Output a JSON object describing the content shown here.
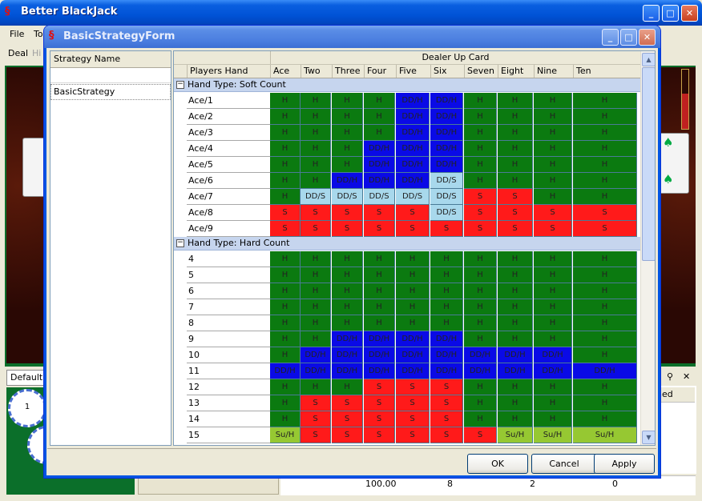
{
  "main_window": {
    "title": "Better BlackJack",
    "menu": [
      "File",
      "To"
    ],
    "toolbar": [
      "Deal",
      "Hi"
    ],
    "default_tab": "Default",
    "right_header_partial": "hed",
    "stats_row": [
      "100.00",
      "8",
      "2",
      "0"
    ],
    "chip_label": "1"
  },
  "dialog": {
    "title": "BasicStrategyForm",
    "strategy_header": "Strategy Name",
    "strategies": [
      "BasicStrategy"
    ],
    "grid": {
      "group_header": "Dealer Up Card",
      "hand_header": "Players Hand",
      "columns": [
        "Ace",
        "Two",
        "Three",
        "Four",
        "Five",
        "Six",
        "Seven",
        "Eight",
        "Nine",
        "Ten"
      ],
      "sections": [
        {
          "label": "Hand Type:  Soft Count",
          "rows": [
            {
              "hand": "Ace/1",
              "cells": [
                "H",
                "H",
                "H",
                "H",
                "DD/H",
                "DD/H",
                "H",
                "H",
                "H",
                "H"
              ]
            },
            {
              "hand": "Ace/2",
              "cells": [
                "H",
                "H",
                "H",
                "H",
                "DD/H",
                "DD/H",
                "H",
                "H",
                "H",
                "H"
              ]
            },
            {
              "hand": "Ace/3",
              "cells": [
                "H",
                "H",
                "H",
                "H",
                "DD/H",
                "DD/H",
                "H",
                "H",
                "H",
                "H"
              ]
            },
            {
              "hand": "Ace/4",
              "cells": [
                "H",
                "H",
                "H",
                "DD/H",
                "DD/H",
                "DD/H",
                "H",
                "H",
                "H",
                "H"
              ]
            },
            {
              "hand": "Ace/5",
              "cells": [
                "H",
                "H",
                "H",
                "DD/H",
                "DD/H",
                "DD/H",
                "H",
                "H",
                "H",
                "H"
              ]
            },
            {
              "hand": "Ace/6",
              "cells": [
                "H",
                "H",
                "DD/H",
                "DD/H",
                "DD/H",
                "DD/S",
                "H",
                "H",
                "H",
                "H"
              ]
            },
            {
              "hand": "Ace/7",
              "cells": [
                "H",
                "DD/S",
                "DD/S",
                "DD/S",
                "DD/S",
                "DD/S",
                "S",
                "S",
                "H",
                "H"
              ]
            },
            {
              "hand": "Ace/8",
              "cells": [
                "S",
                "S",
                "S",
                "S",
                "S",
                "DD/S",
                "S",
                "S",
                "S",
                "S"
              ]
            },
            {
              "hand": "Ace/9",
              "cells": [
                "S",
                "S",
                "S",
                "S",
                "S",
                "S",
                "S",
                "S",
                "S",
                "S"
              ]
            }
          ]
        },
        {
          "label": "Hand Type:  Hard Count",
          "rows": [
            {
              "hand": "4",
              "cells": [
                "H",
                "H",
                "H",
                "H",
                "H",
                "H",
                "H",
                "H",
                "H",
                "H"
              ]
            },
            {
              "hand": "5",
              "cells": [
                "H",
                "H",
                "H",
                "H",
                "H",
                "H",
                "H",
                "H",
                "H",
                "H"
              ]
            },
            {
              "hand": "6",
              "cells": [
                "H",
                "H",
                "H",
                "H",
                "H",
                "H",
                "H",
                "H",
                "H",
                "H"
              ]
            },
            {
              "hand": "7",
              "cells": [
                "H",
                "H",
                "H",
                "H",
                "H",
                "H",
                "H",
                "H",
                "H",
                "H"
              ]
            },
            {
              "hand": "8",
              "cells": [
                "H",
                "H",
                "H",
                "H",
                "H",
                "H",
                "H",
                "H",
                "H",
                "H"
              ]
            },
            {
              "hand": "9",
              "cells": [
                "H",
                "H",
                "DD/H",
                "DD/H",
                "DD/H",
                "DD/H",
                "H",
                "H",
                "H",
                "H"
              ]
            },
            {
              "hand": "10",
              "cells": [
                "H",
                "DD/H",
                "DD/H",
                "DD/H",
                "DD/H",
                "DD/H",
                "DD/H",
                "DD/H",
                "DD/H",
                "H"
              ]
            },
            {
              "hand": "11",
              "cells": [
                "DD/H",
                "DD/H",
                "DD/H",
                "DD/H",
                "DD/H",
                "DD/H",
                "DD/H",
                "DD/H",
                "DD/H",
                "DD/H"
              ]
            },
            {
              "hand": "12",
              "cells": [
                "H",
                "H",
                "H",
                "S",
                "S",
                "S",
                "H",
                "H",
                "H",
                "H"
              ]
            },
            {
              "hand": "13",
              "cells": [
                "H",
                "S",
                "S",
                "S",
                "S",
                "S",
                "H",
                "H",
                "H",
                "H"
              ]
            },
            {
              "hand": "14",
              "cells": [
                "H",
                "S",
                "S",
                "S",
                "S",
                "S",
                "H",
                "H",
                "H",
                "H"
              ]
            },
            {
              "hand": "15",
              "cells": [
                "Su/H",
                "S",
                "S",
                "S",
                "S",
                "S",
                "S",
                "Su/H",
                "Su/H",
                "Su/H"
              ]
            }
          ]
        }
      ]
    },
    "buttons": {
      "ok": "OK",
      "cancel": "Cancel",
      "apply": "Apply"
    }
  },
  "colors": {
    "H": "#0b7a10",
    "S": "#ff1a1a",
    "DD/H": "#0a0ae6",
    "DD/S": "#a8d8ec",
    "Su/H": "#96c832"
  }
}
